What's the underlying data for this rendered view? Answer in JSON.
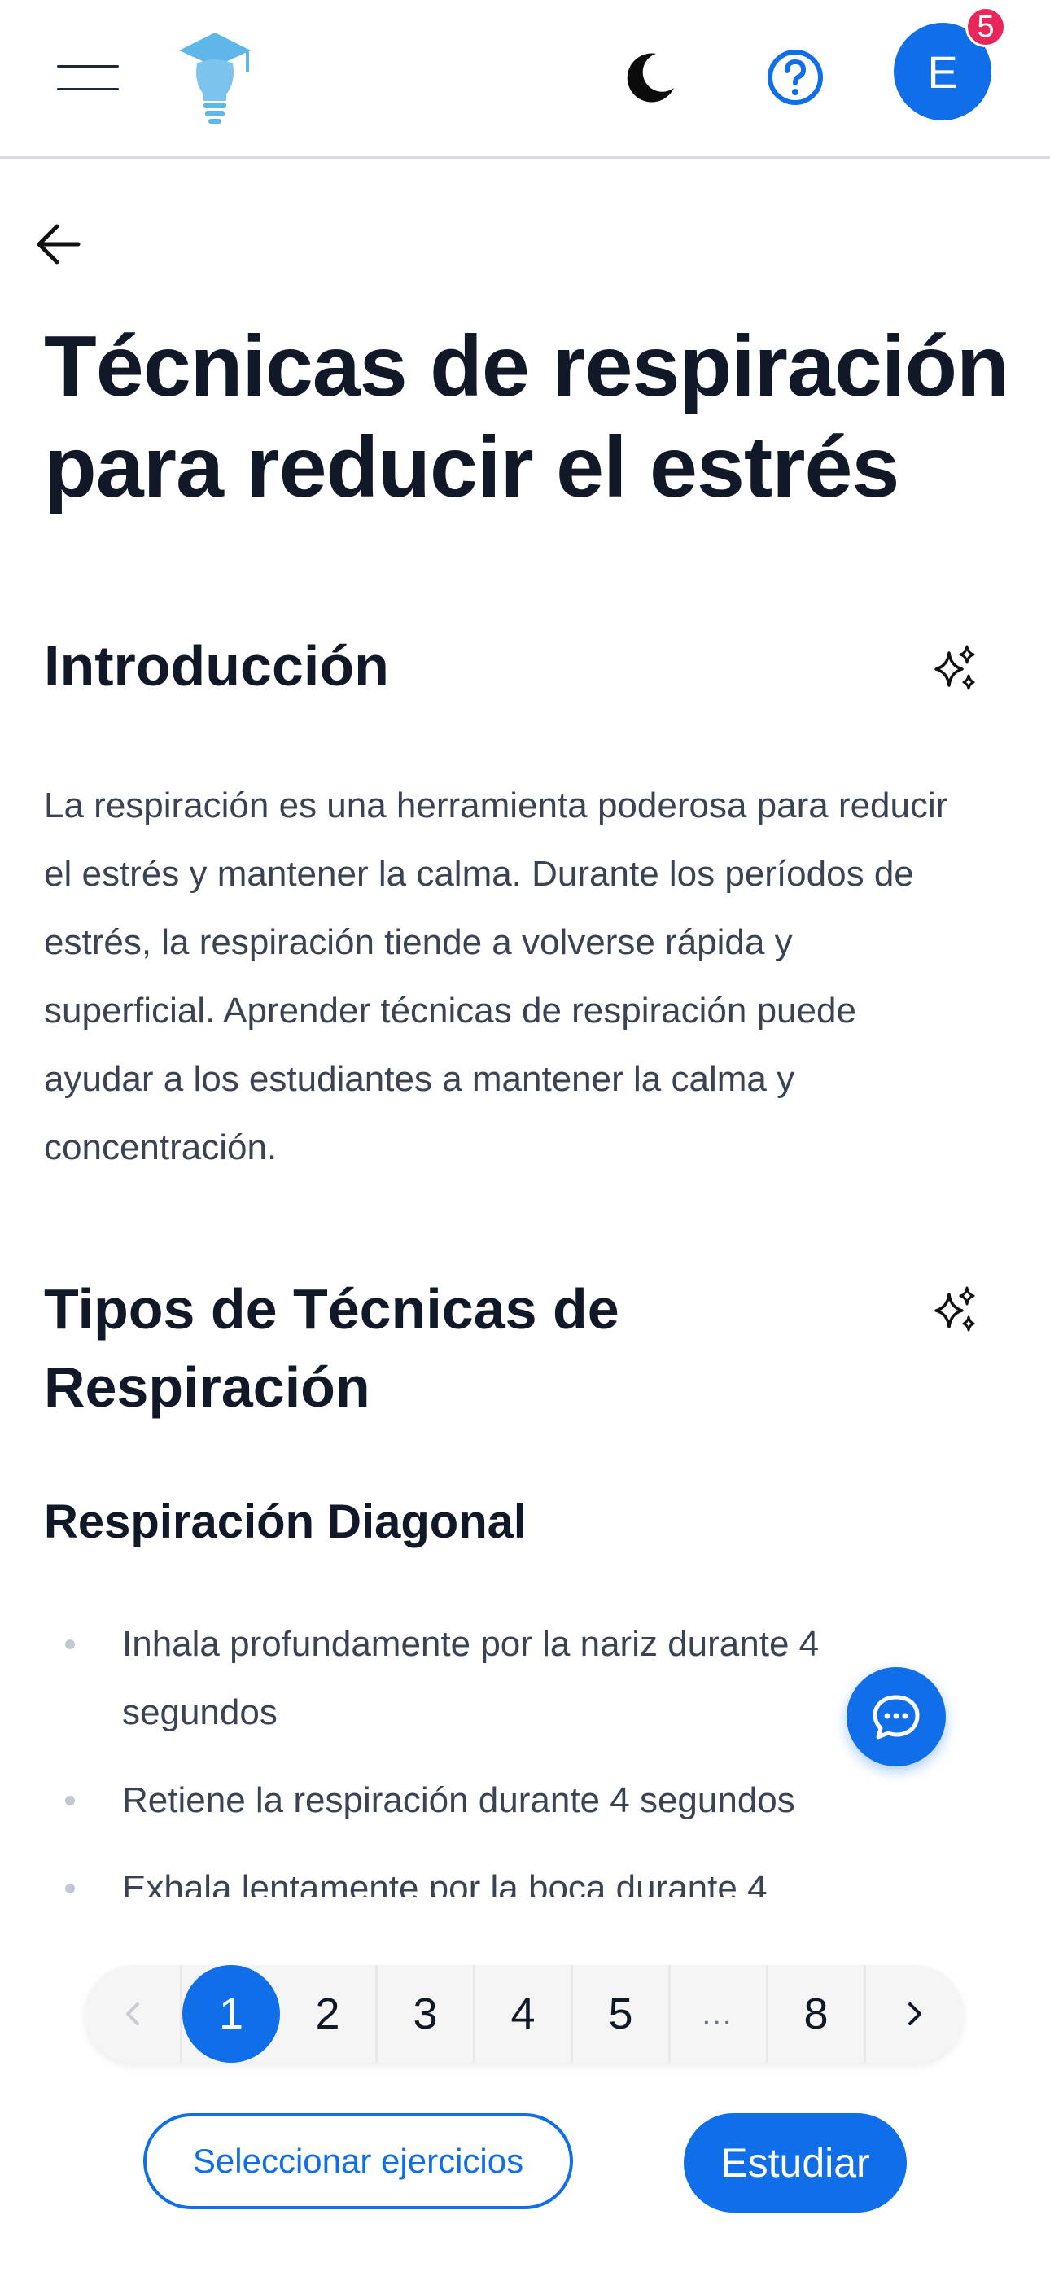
{
  "header": {
    "avatar_initial": "E",
    "notification_count": "5"
  },
  "article": {
    "title": "Técnicas de respiración para reducir el estrés",
    "sections": [
      {
        "heading": "Introducción",
        "body": "La respiración es una herramienta poderosa para reducir el estrés y mantener la calma. Durante los períodos de estrés, la respiración tiende a volverse rápida y superficial. Aprender técnicas de respiración puede ayudar a los estudiantes a mantener la calma y concentración."
      },
      {
        "heading": "Tipos de Técnicas de Respiración",
        "subheading": "Respiración Diagonal",
        "bullets": [
          "Inhala profundamente por la nariz durante 4 segundos",
          "Retiene la respiración durante 4 segundos",
          "Exhala lentamente por la boca durante 4"
        ]
      }
    ]
  },
  "pagination": {
    "prev_icon": "chevron-left-icon",
    "pages": [
      "1",
      "2",
      "3",
      "4",
      "5",
      "…",
      "8"
    ],
    "current": "1",
    "next_icon": "chevron-right-icon"
  },
  "actions": {
    "select_exercises_label": "Seleccionar ejercicios",
    "study_label": "Estudiar"
  },
  "colors": {
    "accent": "#0f6ee8",
    "badge": "#e8265a",
    "logo_light_blue": "#7cc4ee"
  }
}
